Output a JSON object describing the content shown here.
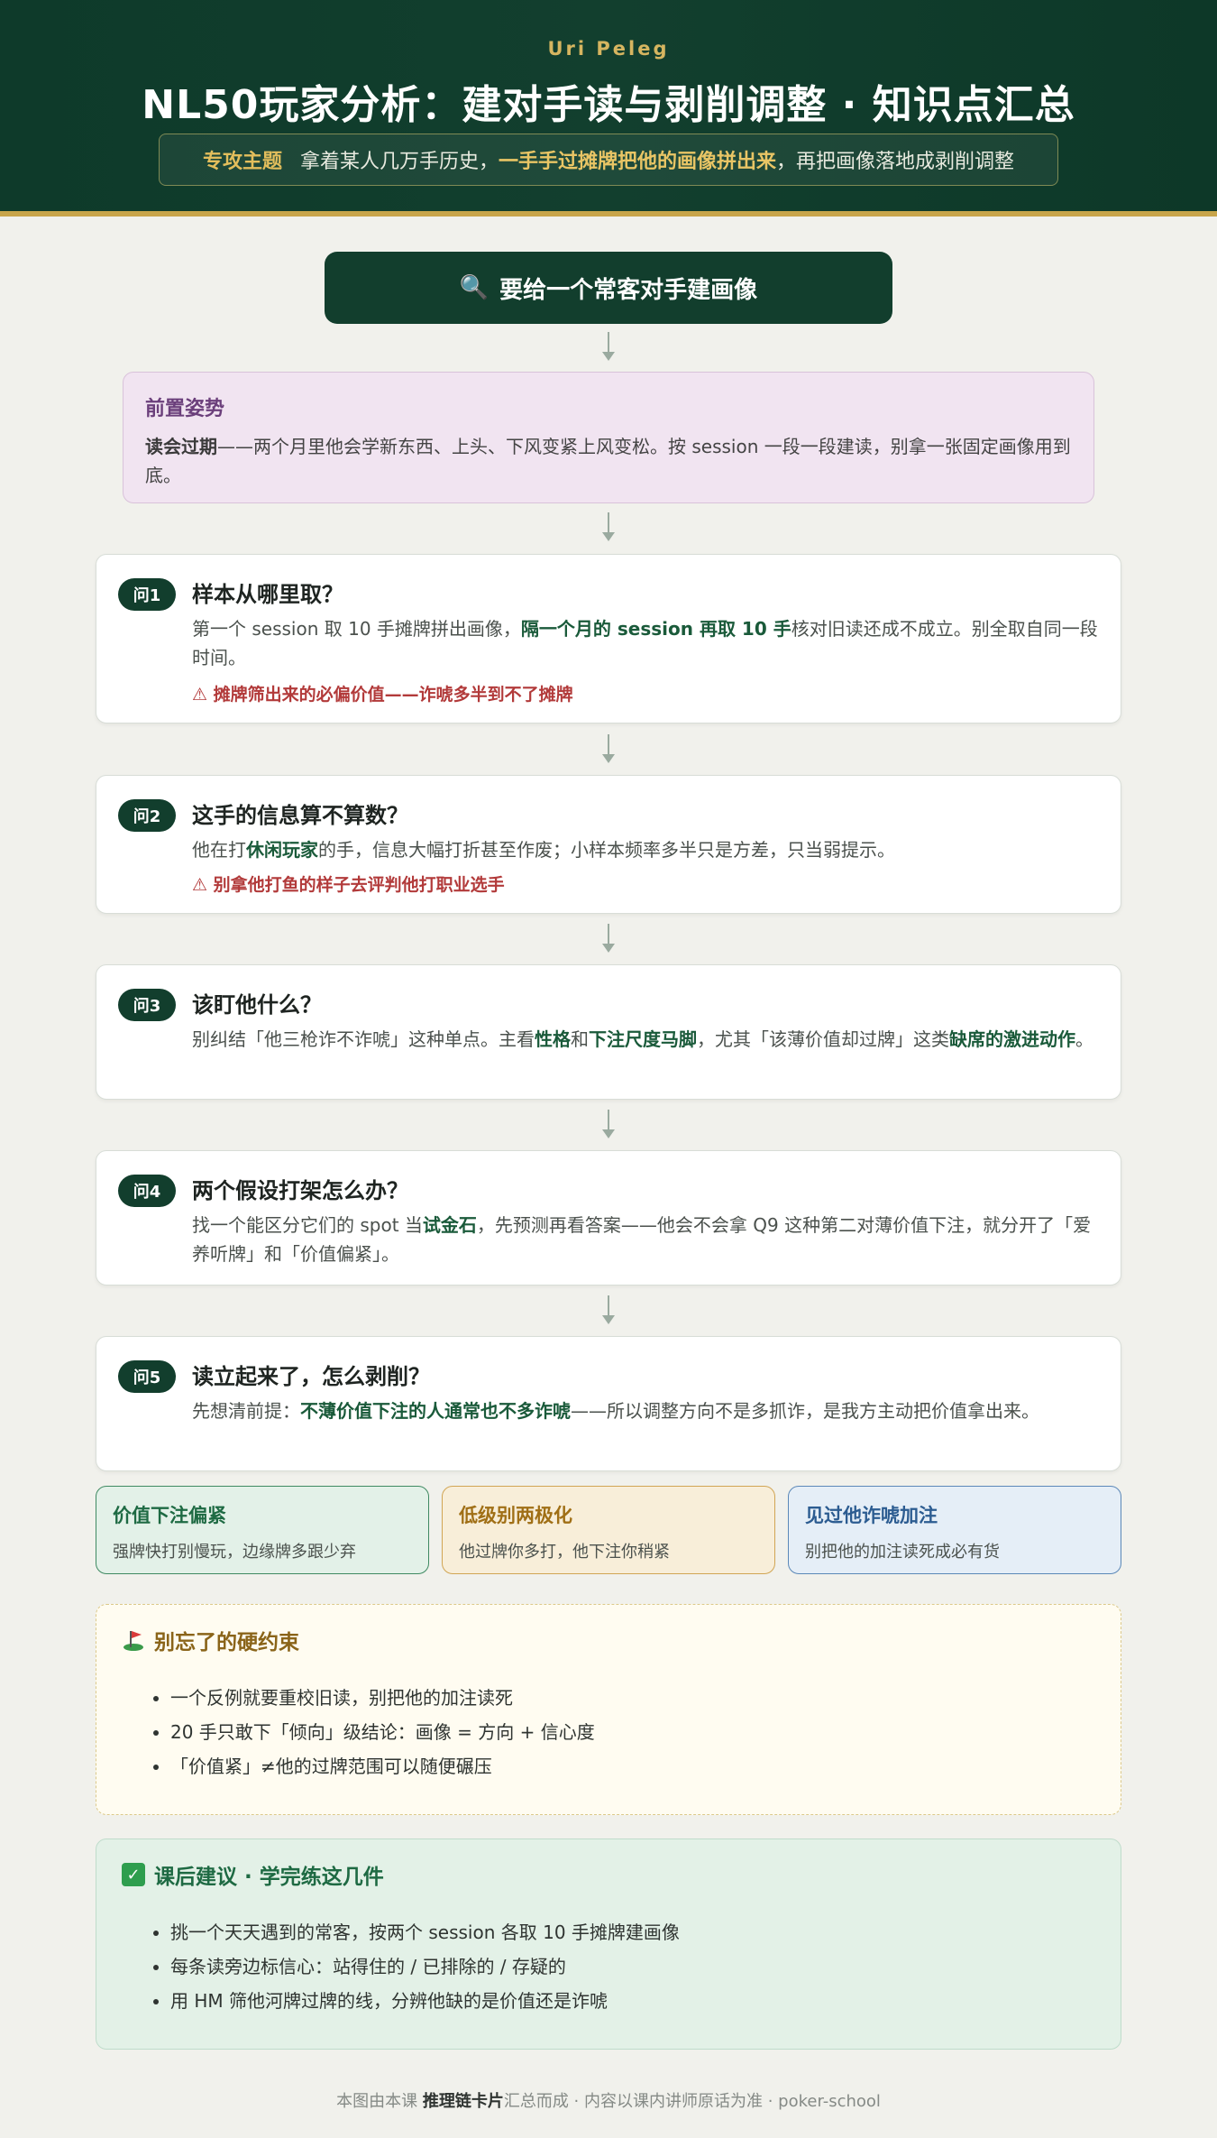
{
  "header": {
    "author": "Uri Peleg",
    "title": "NL50玩家分析：建对手读与剥削调整 · 知识点汇总",
    "topic_tag": "专攻主题",
    "topic_pre": "拿着某人几万手历史，",
    "topic_hl": "一手手过摊牌把他的画像拼出来",
    "topic_post": "，再把画像落地成剥削调整"
  },
  "start": {
    "icon": "magnifier-icon",
    "label": "要给一个常客对手建画像"
  },
  "pre": {
    "title": "前置姿势",
    "bold": "读会过期",
    "text": "——两个月里他会学新东西、上头、下风变紧上风变松。按 session 一段一段建读，别拿一张固定画像用到底。"
  },
  "questions": [
    {
      "badge": "问1",
      "title": "样本从哪里取？",
      "body_pre": "第一个 session 取 10 手摊牌拼出画像，",
      "body_bold": "隔一个月的 session 再取 10 手",
      "body_post": "核对旧读还成不成立。别全取自同一段时间。",
      "warn": "⚠ 摊牌筛出来的必偏价值——诈唬多半到不了摊牌"
    },
    {
      "badge": "问2",
      "title": "这手的信息算不算数？",
      "body_pre": "他在打",
      "body_bold": "休闲玩家",
      "body_post": "的手，信息大幅打折甚至作废；小样本频率多半只是方差，只当弱提示。",
      "warn": "⚠ 别拿他打鱼的样子去评判他打职业选手"
    },
    {
      "badge": "问3",
      "title": "该盯他什么？",
      "body_pre": "别纠结「他三枪诈不诈唬」这种单点。主看",
      "body_bold": "性格",
      "body_mid": "和",
      "body_bold2": "下注尺度马脚",
      "body_mid2": "，尤其「该薄价值却过牌」这类",
      "body_bold3": "缺席的激进动作",
      "body_post": "。"
    },
    {
      "badge": "问4",
      "title": "两个假设打架怎么办？",
      "body_pre": "找一个能区分它们的 spot 当",
      "body_bold": "试金石",
      "body_post": "，先预测再看答案——他会不会拿 Q9 这种第二对薄价值下注，就分开了「爱养听牌」和「价值偏紧」。"
    },
    {
      "badge": "问5",
      "title": "读立起来了，怎么剥削？",
      "body_pre": "先想清前提：",
      "body_bold": "不薄价值下注的人通常也不多诈唬",
      "body_post": "——所以调整方向不是多抓诈，是我方主动把价值拿出来。"
    }
  ],
  "options": [
    {
      "title": "价值下注偏紧",
      "desc": "强牌快打别慢玩，边缘牌多跟少弃",
      "color": "#1e6a43"
    },
    {
      "title": "低级别两极化",
      "desc": "他过牌你多打，他下注你稍紧",
      "color": "#a06f16"
    },
    {
      "title": "见过他诈唬加注",
      "desc": "别把他的加注读死成必有货",
      "color": "#2c5c91"
    }
  ],
  "constraints": {
    "icon": "flag-icon",
    "title": "别忘了的硬约束",
    "items": [
      "一个反例就要重校旧读，别把他的加注读死",
      "20 手只敢下「倾向」级结论：画像 = 方向 + 信心度",
      "「价值紧」≠他的过牌范围可以随便碾压"
    ]
  },
  "advice": {
    "icon": "check-icon",
    "title": "课后建议 · 学完练这几件",
    "items": [
      "挑一个天天遇到的常客，按两个 session 各取 10 手摊牌建画像",
      "每条读旁边标信心：站得住的 / 已排除的 / 存疑的",
      "用 HM 筛他河牌过牌的线，分辨他缺的是价值还是诈唬"
    ]
  },
  "footer": {
    "pre": "本图由本课 ",
    "bold": "推理链卡片",
    "post": "汇总而成 · 内容以课内讲师原话为准 · poker-school"
  }
}
